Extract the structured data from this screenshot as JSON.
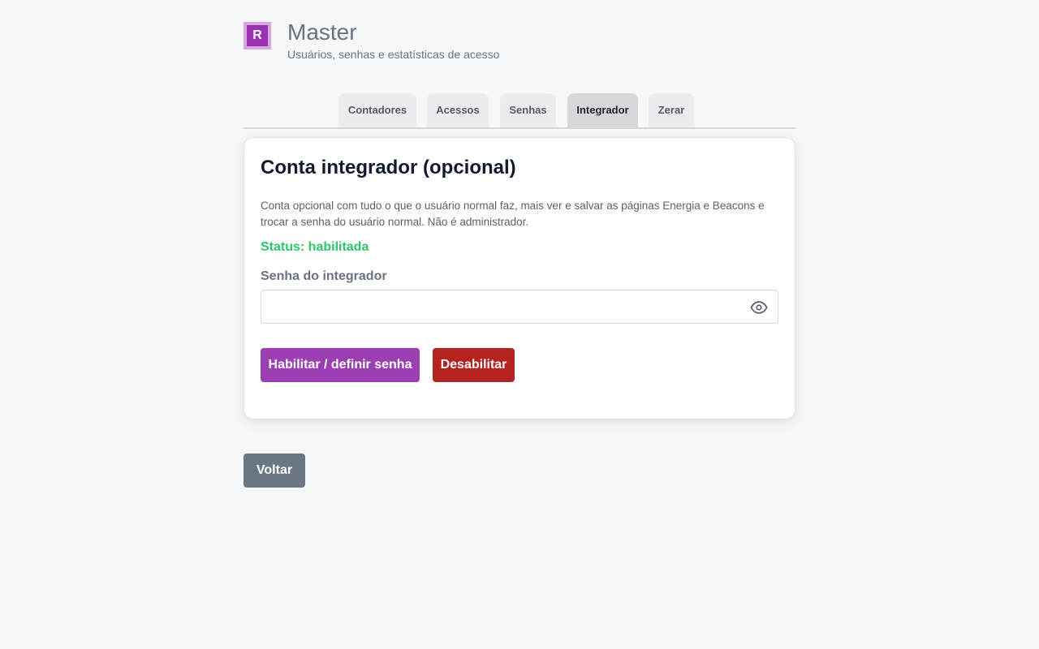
{
  "header": {
    "logo_letter": "R",
    "title": "Master",
    "subtitle": "Usuários, senhas e estatísticas de acesso"
  },
  "tabs": [
    {
      "label": "Contadores",
      "active": false
    },
    {
      "label": "Acessos",
      "active": false
    },
    {
      "label": "Senhas",
      "active": false
    },
    {
      "label": "Integrador",
      "active": true
    },
    {
      "label": "Zerar",
      "active": false
    }
  ],
  "card": {
    "title": "Conta integrador (opcional)",
    "description": "Conta opcional com tudo o que o usuário normal faz, mais ver e salvar as páginas Energia e Beacons e trocar a senha do usuário normal. Não é administrador.",
    "status": "Status: habilitada",
    "password_label": "Senha do integrador",
    "password_value": "",
    "password_icon": "eye-icon",
    "enable_button": "Habilitar / definir senha",
    "disable_button": "Desabilitar"
  },
  "back_button": "Voltar",
  "colors": {
    "brand": "#9b33b0",
    "status_ok": "#2ec46a",
    "danger": "#b4231f",
    "secondary": "#6b7683"
  }
}
